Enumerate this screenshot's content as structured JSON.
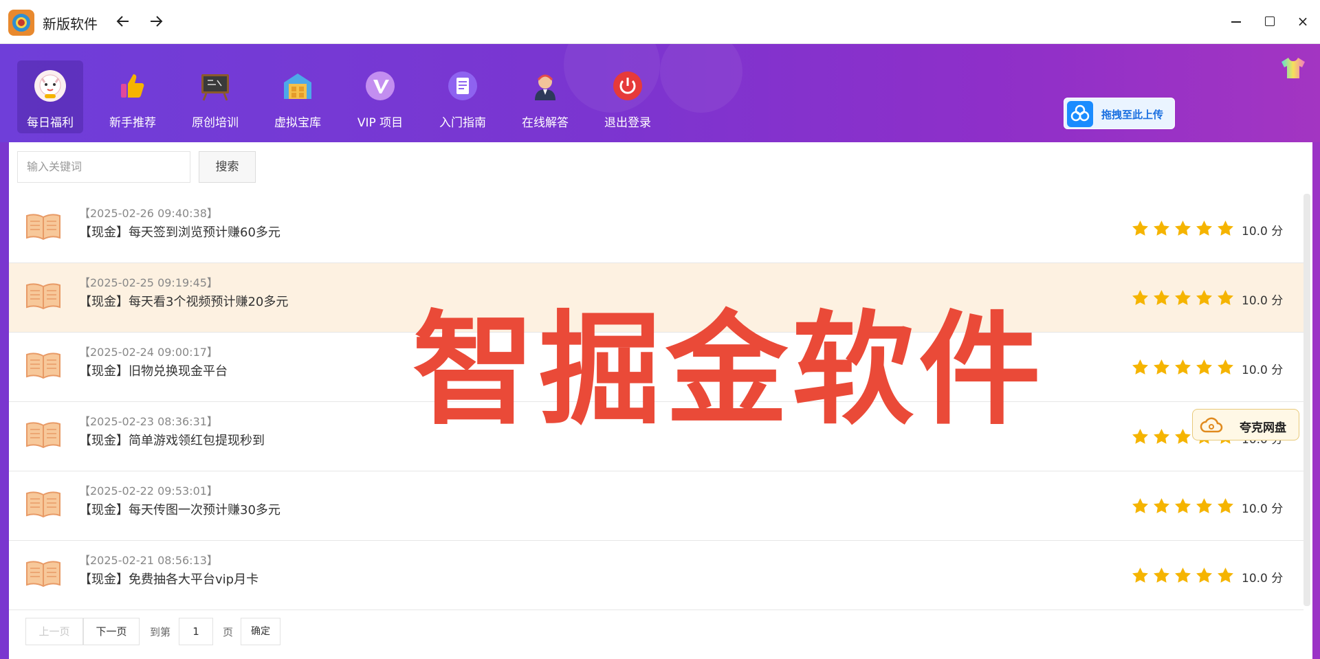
{
  "window": {
    "title": "新版软件",
    "back_icon": "arrow-left-icon",
    "forward_icon": "arrow-right-icon",
    "minimize_icon": "minimize-icon",
    "maximize_icon": "maximize-icon",
    "close_label": "×"
  },
  "nav": {
    "items": [
      {
        "label": "每日福利",
        "icon": "lucky-cat-icon",
        "active": true
      },
      {
        "label": "新手推荐",
        "icon": "thumbs-up-icon"
      },
      {
        "label": "原创培训",
        "icon": "blackboard-icon"
      },
      {
        "label": "虚拟宝库",
        "icon": "warehouse-icon"
      },
      {
        "label": "VIP 项目",
        "icon": "vip-icon"
      },
      {
        "label": "入门指南",
        "icon": "document-icon"
      },
      {
        "label": "在线解答",
        "icon": "support-agent-icon"
      },
      {
        "label": "退出登录",
        "icon": "power-icon"
      }
    ],
    "upload_label": "拖拽至此上传",
    "skin_icon": "tshirt-icon"
  },
  "search": {
    "placeholder": "输入关键词",
    "button_label": "搜索"
  },
  "list": [
    {
      "date": "【2025-02-26 09:40:38】",
      "title": "【现金】每天签到浏览预计赚60多元",
      "rating": 5,
      "score": "10.0 分"
    },
    {
      "date": "【2025-02-25 09:19:45】",
      "title": "【现金】每天看3个视频预计赚20多元",
      "rating": 5,
      "score": "10.0 分",
      "highlighted": true
    },
    {
      "date": "【2025-02-24 09:00:17】",
      "title": "【现金】旧物兑换现金平台",
      "rating": 5,
      "score": "10.0 分"
    },
    {
      "date": "【2025-02-23 08:36:31】",
      "title": "【现金】简单游戏领红包提现秒到",
      "rating": 5,
      "score": "10.0 分"
    },
    {
      "date": "【2025-02-22 09:53:01】",
      "title": "【现金】每天传图一次预计赚30多元",
      "rating": 5,
      "score": "10.0 分"
    },
    {
      "date": "【2025-02-21 08:56:13】",
      "title": "【现金】免费抽各大平台vip月卡",
      "rating": 5,
      "score": "10.0 分"
    }
  ],
  "watermark": "智掘金软件",
  "quark_badge": "夸克网盘",
  "pager": {
    "prev_label": "上一页",
    "next_label": "下一页",
    "goto_label": "到第",
    "page_value": "1",
    "page_suffix": "页",
    "confirm_label": "确定"
  },
  "colors": {
    "header_start": "#6f3ed9",
    "header_end": "#a335c2",
    "star": "#f5b400",
    "highlight_row": "#fdf1e1",
    "watermark": "#ea4a38"
  }
}
